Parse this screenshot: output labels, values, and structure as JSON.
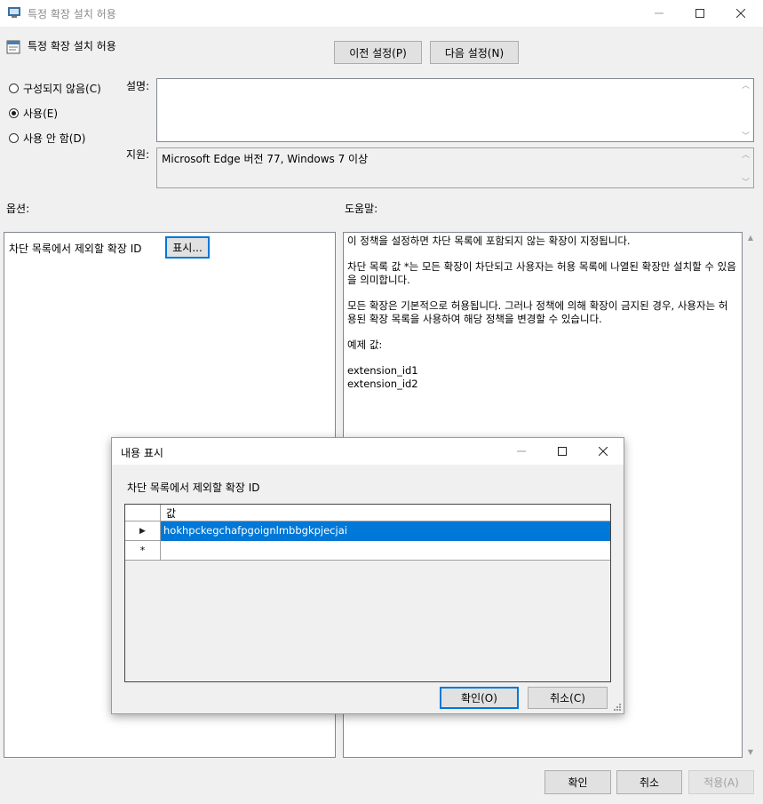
{
  "window": {
    "title": "특정 확장 설치 허용"
  },
  "policy": {
    "title": "특정 확장 설치 허용"
  },
  "nav": {
    "prev": "이전 설정(P)",
    "next": "다음 설정(N)"
  },
  "state_options": {
    "not_configured": "구성되지 않음(C)",
    "enabled": "사용(E)",
    "disabled": "사용 안 함(D)",
    "selected": "enabled"
  },
  "labels": {
    "comment": "설명:",
    "supported": "지원:",
    "options": "옵션:",
    "help": "도움말:"
  },
  "comment": {
    "value": ""
  },
  "supported_on": "Microsoft Edge 버전 77, Windows 7 이상",
  "options_panel": {
    "list_label": "차단 목록에서 제외할 확장 ID",
    "show_button": "표시..."
  },
  "help": {
    "p1": "이 정책을 설정하면 차단 목록에 포함되지 않는 확장이 지정됩니다.",
    "p2": "차단 목록 값 *는 모든 확장이 차단되고 사용자는 허용 목록에 나열된 확장만 설치할 수 있음을 의미합니다.",
    "p3": "모든 확장은 기본적으로 허용됩니다. 그러나 정책에 의해 확장이 금지된 경우, 사용자는 허용된 확장 목록을 사용하여 해당 정책을 변경할 수 있습니다.",
    "p4": "예제 값:",
    "example1": "extension_id1",
    "example2": "extension_id2"
  },
  "dialog": {
    "title": "내용 표시",
    "heading": "차단 목록에서 제외할 확장 ID",
    "column_header": "값",
    "rows": [
      {
        "marker": "▶",
        "value": "hokhpckegchafpgoignlmbbgkpjecjai",
        "selected": true
      },
      {
        "marker": "*",
        "value": "",
        "selected": false
      }
    ],
    "ok": "확인(O)",
    "cancel": "취소(C)"
  },
  "footer": {
    "ok": "확인",
    "cancel": "취소",
    "apply": "적용(A)"
  },
  "colors": {
    "selection": "#0078d7",
    "focus_border": "#0078d7"
  }
}
